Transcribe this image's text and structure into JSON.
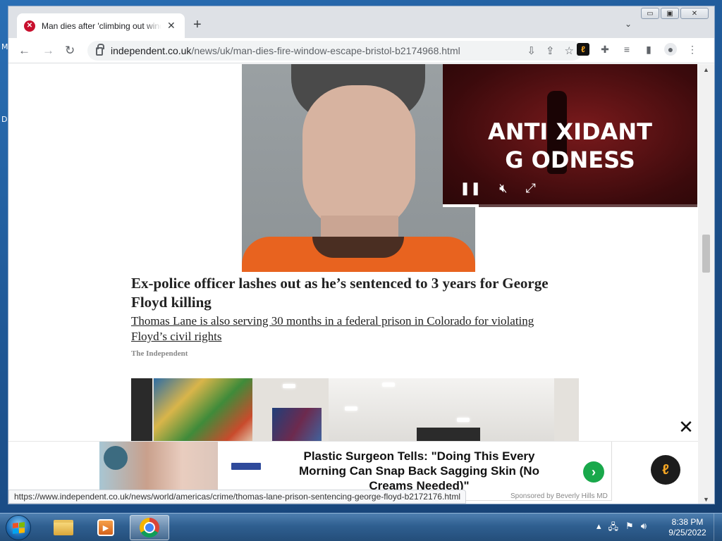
{
  "desktop": {
    "letters": [
      "M",
      "D"
    ]
  },
  "window": {
    "tab_title": "Man dies after 'climbing out window",
    "tab_favicon": "independent-eagle-icon",
    "window_controls": [
      "minimize",
      "maximize",
      "close"
    ]
  },
  "toolbar": {
    "url_domain": "independent.co.uk",
    "url_path": "/news/uk/man-dies-fire-window-escape-bristol-b2174968.html"
  },
  "article": {
    "headline": "Ex-police officer lashes out as he’s sentenced to 3 years for George Floyd killing",
    "subheadline": "Thomas Lane is also serving 30 months in a federal prison in Colorado for violating Floyd’s civil rights",
    "source": "The Independent"
  },
  "video_ad": {
    "line1": "ANTI  XIDANT",
    "line2": "G  ODNESS",
    "progress": 0.14
  },
  "bottom_ad": {
    "text": "Plastic Surgeon Tells: \"Doing This Every Morning Can Snap Back Sagging Skin (No Creams Needed)\"",
    "sponsor": "Sponsored by Beverly Hills MD",
    "logo_text": "BEVERLY HILLS MD",
    "go_icon": "chevron-right-icon",
    "close_icon": "close-icon"
  },
  "status_bar": {
    "url": "https://www.independent.co.uk/news/world/americas/crime/thomas-lane-prison-sentencing-george-floyd-b2172176.html"
  },
  "taskbar": {
    "apps": [
      "windows-explorer",
      "media-player",
      "google-chrome"
    ],
    "time": "8:38 PM",
    "date": "9/25/2022"
  },
  "colors": {
    "accent_red": "#c8102e",
    "honey_orange": "#f5a623",
    "ad_green": "#19a84b"
  }
}
